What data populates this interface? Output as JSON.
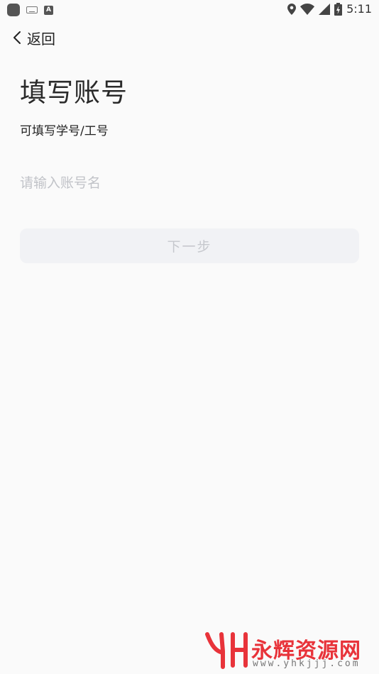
{
  "status_bar": {
    "time": "5:11",
    "icons": [
      "app-icon",
      "keyboard-icon",
      "input-method-icon",
      "location-icon",
      "wifi-icon",
      "signal-icon",
      "battery-charging-icon"
    ]
  },
  "nav": {
    "back_label": "返回"
  },
  "page": {
    "title": "填写账号",
    "subtitle": "可填写学号/工号"
  },
  "account_input": {
    "value": "",
    "placeholder": "请输入账号名"
  },
  "next_button": {
    "label": "下一步"
  },
  "watermark": {
    "name": "永辉资源网",
    "url": "www.yhkjjj.com"
  },
  "colors": {
    "background": "#fafafa",
    "button_disabled_bg": "#f1f2f5",
    "button_disabled_text": "#c6c8cd",
    "placeholder": "#c1c3c8",
    "watermark_red": "#e8333a"
  }
}
